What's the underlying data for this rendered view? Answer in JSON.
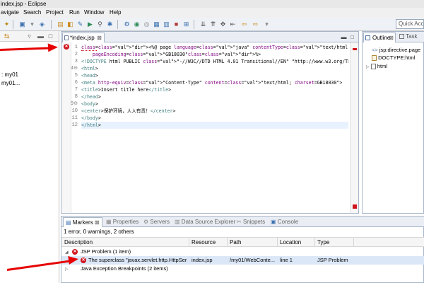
{
  "window": {
    "title": "index.jsp - Eclipse"
  },
  "menu": [
    "avigate",
    "Search",
    "Project",
    "Run",
    "Window",
    "Help"
  ],
  "toolbar": {
    "quick_access_placeholder": "Quick Acce"
  },
  "left_panel": {
    "items": [
      ": my01",
      "my01..."
    ]
  },
  "editor": {
    "tab_label": "*index.jsp",
    "close_glyph": "⊠",
    "lines": [
      {
        "n": "1",
        "marker": "error",
        "text": "<%@ page language=\"java\" contentType=\"text/html; charset=GB18030\""
      },
      {
        "n": "2",
        "text": "    pageEncoding=\"GB18030\"%>"
      },
      {
        "n": "3",
        "text": "<!DOCTYPE html PUBLIC \"-//W3C//DTD HTML 4.01 Transitional//EN\" \"http://www.w3.org/TR/html4/"
      },
      {
        "n": "4⊖",
        "text": "<html>"
      },
      {
        "n": "5",
        "text": "<head>"
      },
      {
        "n": "6",
        "text": "<meta http-equiv=\"Content-Type\" content=\"text/html; charset=GB18030\">"
      },
      {
        "n": "7",
        "text": "<title>Insert title here</title>"
      },
      {
        "n": "8",
        "text": "</head>"
      },
      {
        "n": "9⊖",
        "text": "<body>"
      },
      {
        "n": "10",
        "text": "<center>保护环境，人人有责！</center>"
      },
      {
        "n": "11",
        "text": "</body>"
      },
      {
        "n": "12",
        "text": "</html>",
        "current": true
      }
    ]
  },
  "outline": {
    "tab_label": "Outline",
    "other_tab_label": "Task",
    "items": [
      {
        "label": "jsp:directive.page",
        "icon": "directive-icon",
        "indent": 0
      },
      {
        "label": "DOCTYPE:html",
        "icon": "doctype-icon",
        "indent": 0
      },
      {
        "label": "html",
        "icon": "element-icon",
        "indent": 0,
        "expandable": true
      }
    ]
  },
  "markers": {
    "tabs": [
      "Markers",
      "Properties",
      "Servers",
      "Data Source Explorer",
      "Snippets",
      "Console"
    ],
    "summary": "1 error, 0 warnings, 2 others",
    "columns": [
      "Description",
      "Resource",
      "Path",
      "Location",
      "Type"
    ],
    "rows": [
      {
        "kind": "group",
        "label": "JSP Problem (1 item)",
        "icon": "error-icon",
        "expanded": true
      },
      {
        "kind": "item",
        "selected": true,
        "description": "The superclass \"javax.servlet.http.HttpSer",
        "resource": "index.jsp",
        "path": "/my01/WebConte...",
        "location": "line 1",
        "type": "JSP Problem"
      },
      {
        "kind": "group",
        "label": "Java Exception Breakpoints (2 items)",
        "expanded": false
      }
    ]
  },
  "colors": {
    "error": "#d0141c",
    "annotation_arrow": "#e60000",
    "selection": "#dbe7f7"
  }
}
